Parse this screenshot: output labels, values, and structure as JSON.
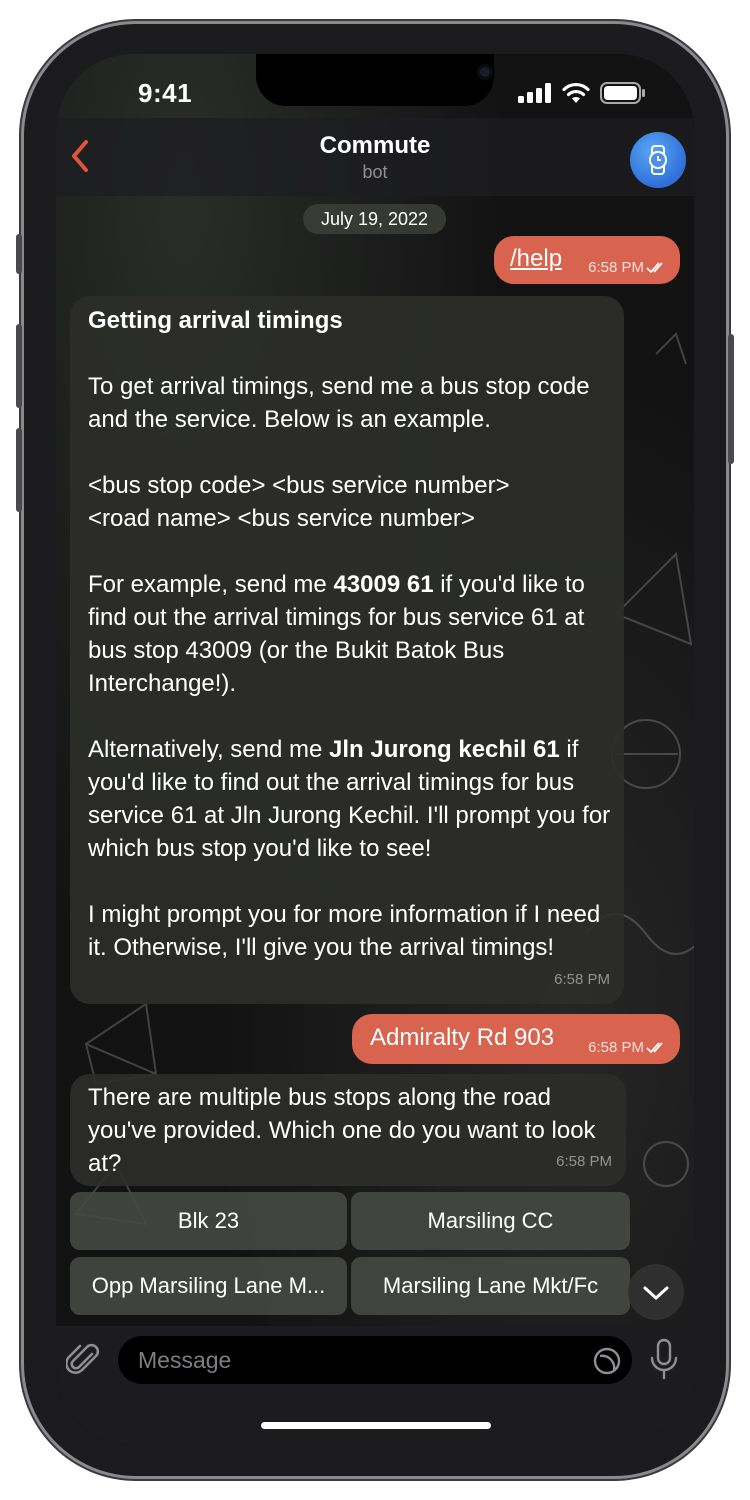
{
  "status": {
    "time": "9:41"
  },
  "header": {
    "back_icon": "chevron-left-icon",
    "title": "Commute",
    "subtitle": "bot",
    "avatar_icon": "watch-icon"
  },
  "date_chip": "July 19, 2022",
  "messages": {
    "m1": {
      "text": "/help",
      "time": "6:58 PM"
    },
    "m2": {
      "heading": "Getting arrival timings",
      "p1": "To get arrival timings, send me a bus stop code and the service. Below is an example.",
      "p2a": "<bus stop code> <bus service number>",
      "p2b": "<road name> <bus service number>",
      "p3_pre": "For example, send me ",
      "p3_bold": "43009 61",
      "p3_post": " if you'd like to find out the arrival timings for bus service 61 at bus stop 43009 (or the Bukit Batok Bus Interchange!).",
      "p4_pre": "Alternatively, send me ",
      "p4_bold": "Jln Jurong kechil 61",
      "p4_post": " if you'd like to find out the arrival timings for bus service 61 at Jln Jurong Kechil. I'll prompt you for which bus stop you'd like to see!",
      "p5": "I might prompt you for more information if I need it. Otherwise, I'll give you the arrival timings!",
      "time": "6:58 PM"
    },
    "m3": {
      "text": "Admiralty Rd 903",
      "time": "6:58 PM"
    },
    "m4": {
      "text": "There are multiple bus stops along the road you've provided. Which one do you want to look at?",
      "time": "6:58 PM"
    }
  },
  "keyboard": {
    "b1": "Blk 23",
    "b2": "Marsiling CC",
    "b3": "Opp Marsiling Lane M...",
    "b4": "Marsiling Lane Mkt/Fc"
  },
  "input": {
    "placeholder": "Message",
    "attach_icon": "paperclip-icon",
    "sticker_icon": "sticker-icon",
    "mic_icon": "microphone-icon"
  },
  "colors": {
    "outgoing": "#d8644f",
    "incoming": "#2c2e2a",
    "accent": "#e0533d"
  }
}
